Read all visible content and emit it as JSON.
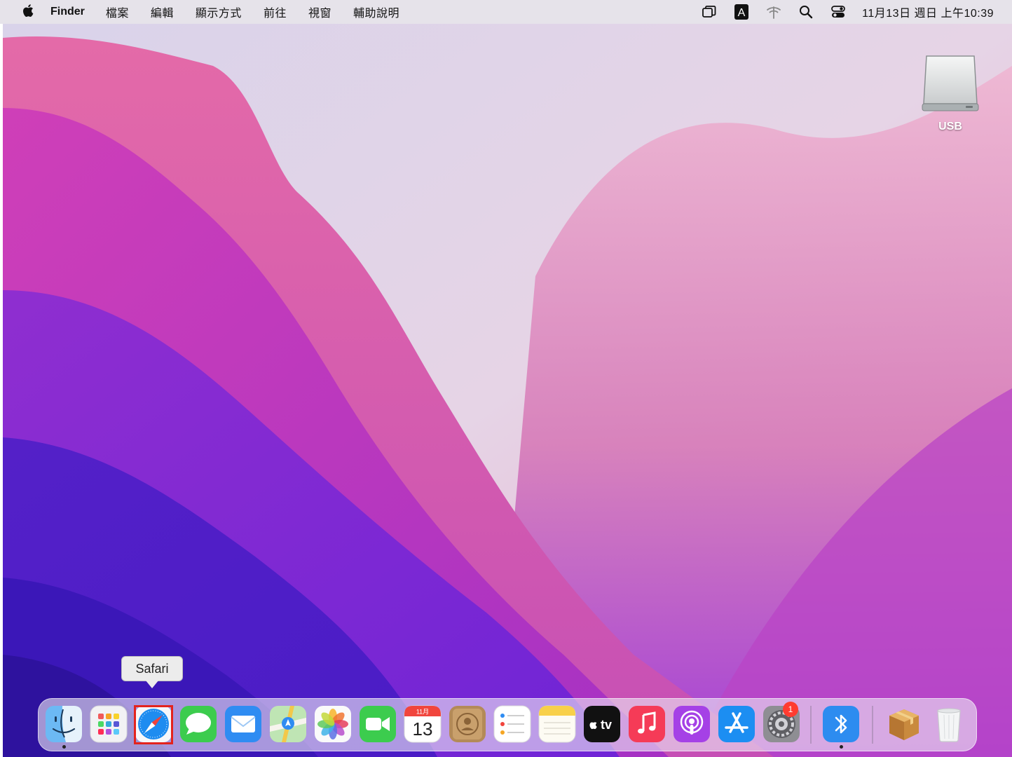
{
  "menubar": {
    "apple_icon": "apple-icon",
    "app_name": "Finder",
    "menus": [
      "檔案",
      "編輯",
      "顯示方式",
      "前往",
      "視窗",
      "輔助說明"
    ],
    "status_icons": [
      "window-stack-icon",
      "input-method-a-icon",
      "wifi-icon",
      "search-icon",
      "control-center-icon"
    ],
    "input_method_label": "A",
    "clock": "11月13日 週日 上午10:39"
  },
  "desktop": {
    "usb_label": "USB"
  },
  "tooltip": {
    "text": "Safari"
  },
  "dock": {
    "apps": [
      {
        "name": "Finder",
        "icon": "finder-icon",
        "running": true
      },
      {
        "name": "Launchpad",
        "icon": "launchpad-icon",
        "running": false
      },
      {
        "name": "Safari",
        "icon": "safari-icon",
        "running": false,
        "selected": true
      },
      {
        "name": "Messages",
        "icon": "messages-icon",
        "running": false
      },
      {
        "name": "Mail",
        "icon": "mail-icon",
        "running": false
      },
      {
        "name": "Maps",
        "icon": "maps-icon",
        "running": false
      },
      {
        "name": "Photos",
        "icon": "photos-icon",
        "running": false
      },
      {
        "name": "FaceTime",
        "icon": "facetime-icon",
        "running": false
      },
      {
        "name": "Calendar",
        "icon": "calendar-icon",
        "running": false
      },
      {
        "name": "Contacts",
        "icon": "contacts-icon",
        "running": false
      },
      {
        "name": "Reminders",
        "icon": "reminders-icon",
        "running": false
      },
      {
        "name": "Notes",
        "icon": "notes-icon",
        "running": false
      },
      {
        "name": "TV",
        "icon": "tv-icon",
        "running": false
      },
      {
        "name": "Music",
        "icon": "music-icon",
        "running": false
      },
      {
        "name": "Podcasts",
        "icon": "podcasts-icon",
        "running": false
      },
      {
        "name": "App Store",
        "icon": "app-store-icon",
        "running": false
      },
      {
        "name": "System Preferences",
        "icon": "system-preferences-icon",
        "running": false,
        "badge": "1"
      },
      {
        "name": "Bluetooth File Exchange",
        "icon": "bluetooth-icon",
        "running": true
      },
      {
        "name": "Installer",
        "icon": "installer-package-icon",
        "running": false
      },
      {
        "name": "Trash",
        "icon": "trash-icon",
        "running": false
      }
    ],
    "calendar_month": "11月",
    "calendar_day": "13",
    "tv_label": "tv",
    "system_preferences_badge": "1"
  },
  "colors": {
    "menubar_bg": "#e6e3ea",
    "selection_outline": "#e4231d",
    "badge": "#ff3b30"
  }
}
